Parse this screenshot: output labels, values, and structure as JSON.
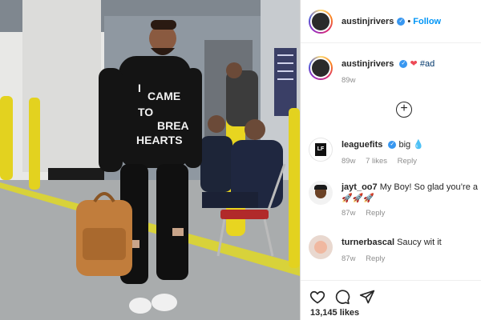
{
  "post": {
    "author": "austinjrivers",
    "follow_label": "Follow",
    "separator": "•"
  },
  "caption": {
    "username": "austinjrivers",
    "heart": "❤",
    "text": "#ad",
    "time": "89w"
  },
  "shirt_text": [
    "I",
    "CAME",
    "TO",
    "BREA",
    "HEARTS"
  ],
  "comments": [
    {
      "username": "leaguefits",
      "text": "big 💧",
      "time": "89w",
      "likes": "7 likes",
      "reply": "Reply",
      "avatar_text": "LF"
    },
    {
      "username": "jayt_oo7",
      "text": "My Boy! So glad you’re a",
      "text2": "🚀🚀🚀",
      "time": "87w",
      "reply": "Reply"
    },
    {
      "username": "turnerbascal",
      "text": "Saucy wit it",
      "time": "87w",
      "reply": "Reply"
    }
  ],
  "likes_count": "13,145 likes",
  "colors": {
    "accent": "#0095f6",
    "verified": "#3897f0",
    "yellow_post": "#e6d21c"
  }
}
